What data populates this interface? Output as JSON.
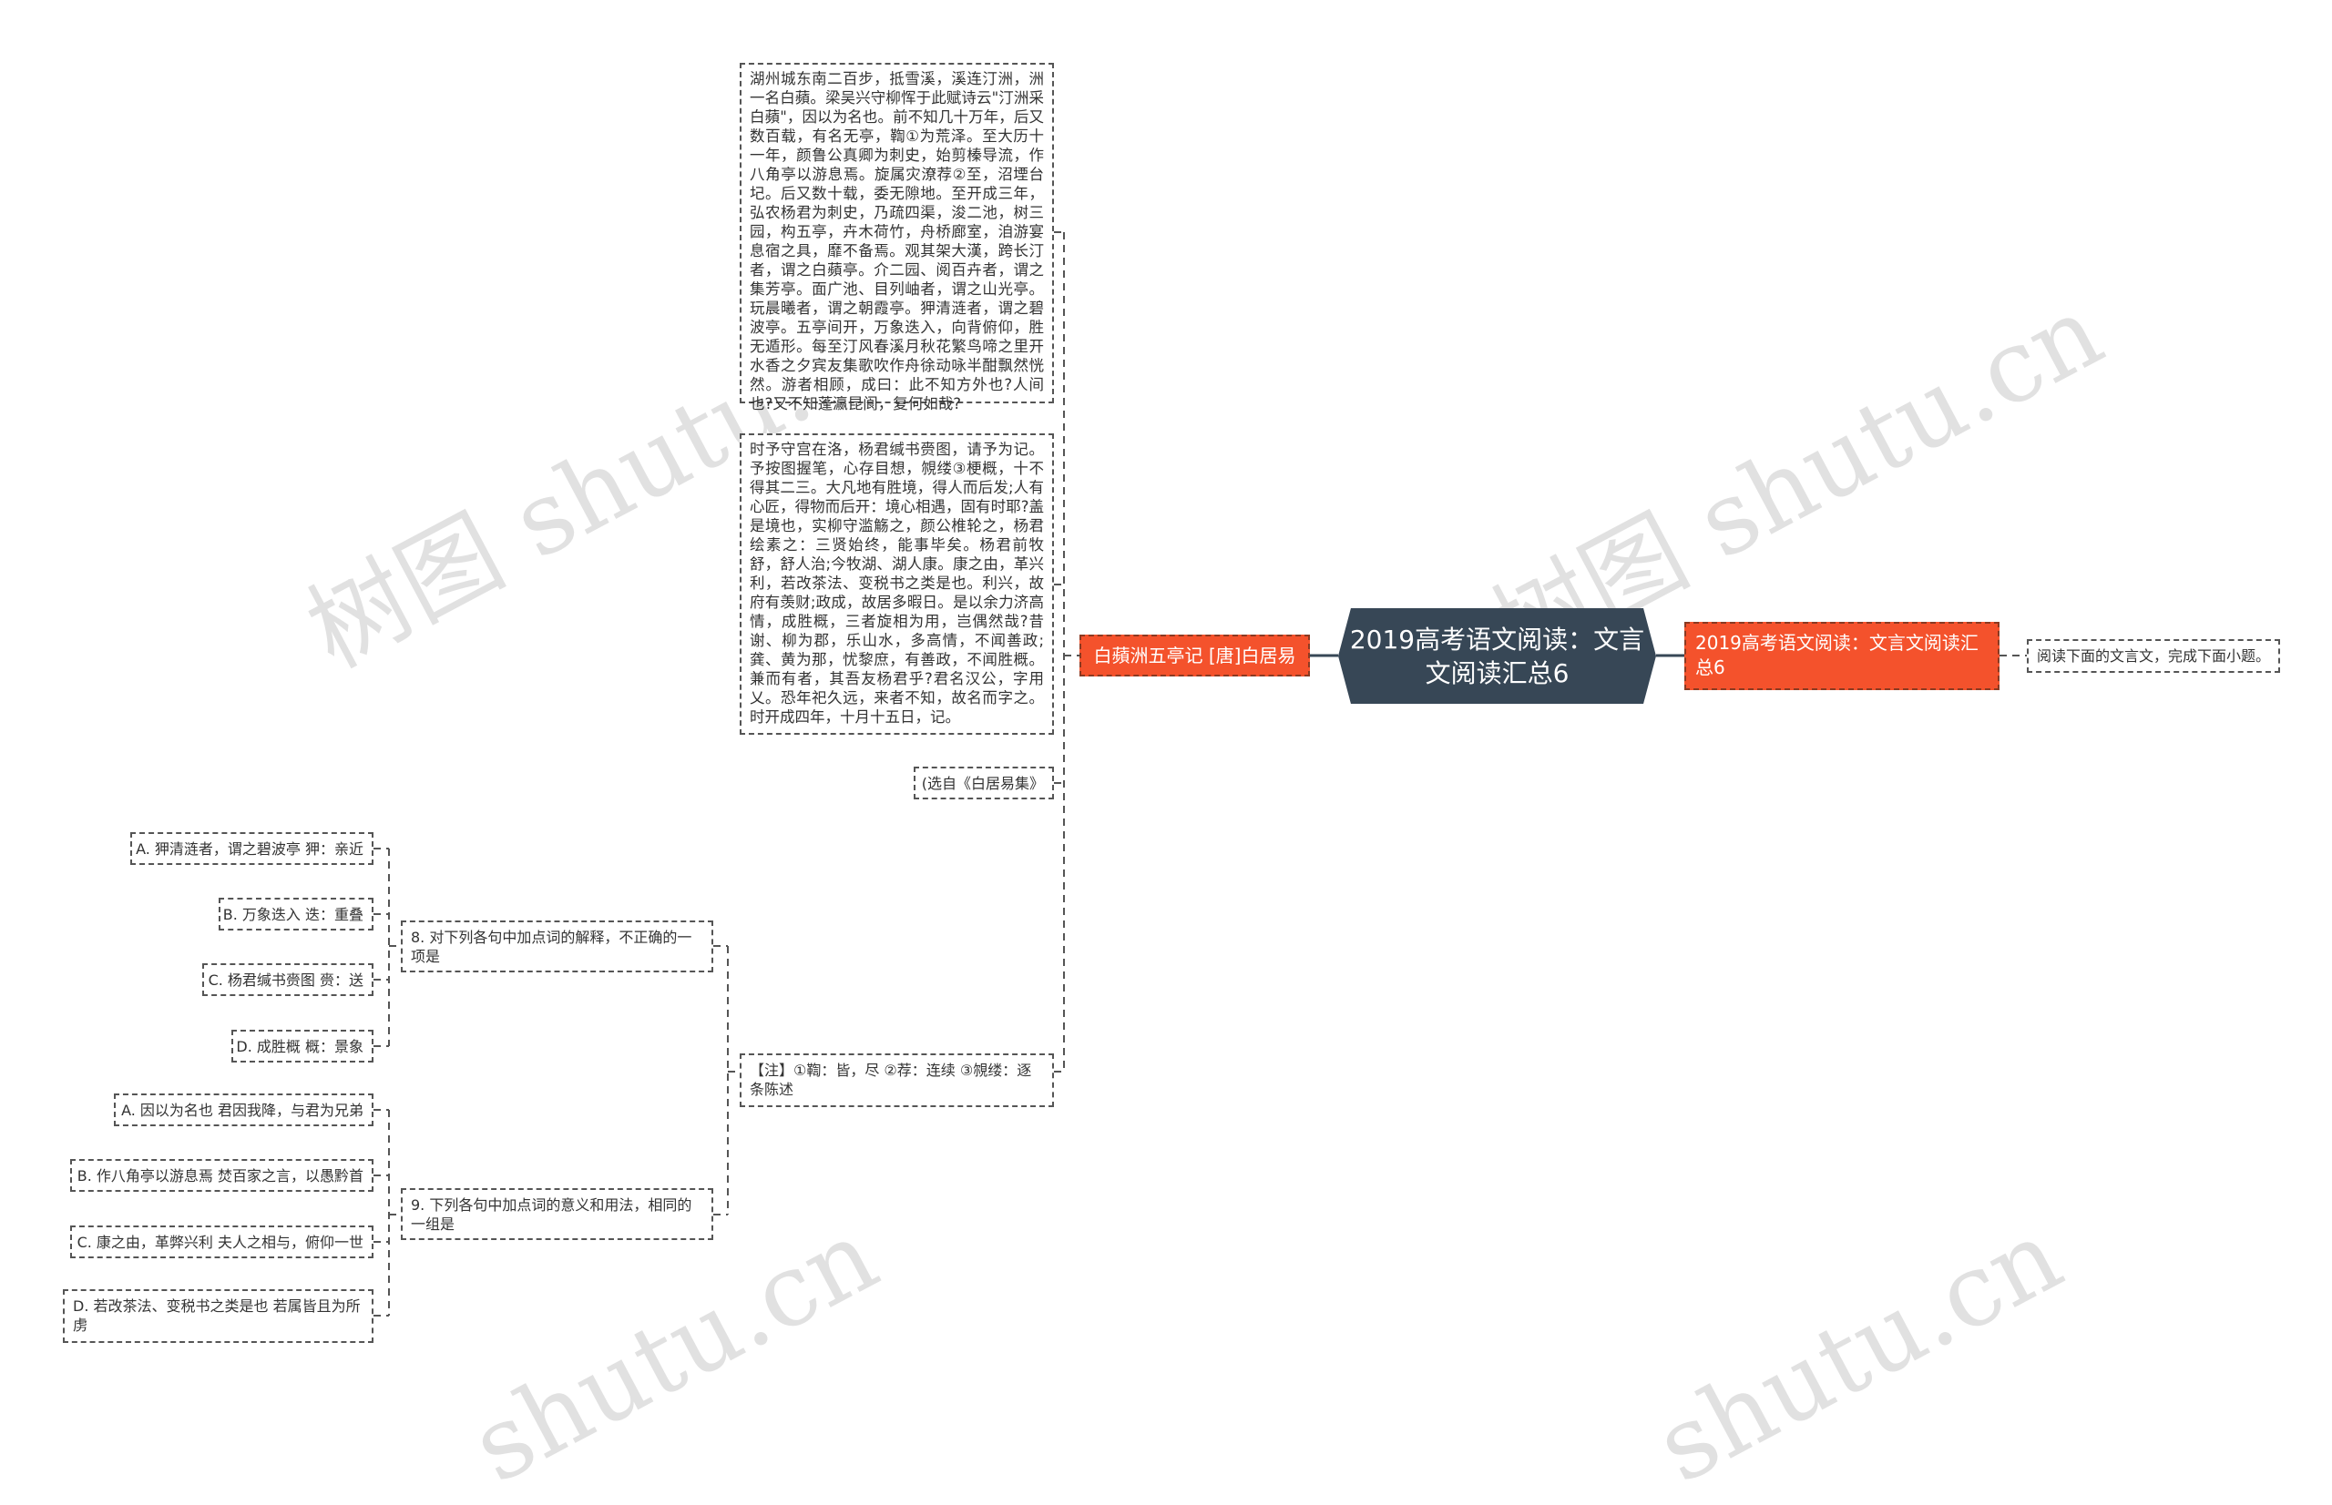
{
  "root": {
    "title": "2019高考语文阅读：文言文阅读汇总6"
  },
  "right_branch": {
    "label": "2019高考语文阅读：文言文阅读汇总6",
    "child": "阅读下面的文言文，完成下面小题。"
  },
  "left_branch": {
    "label": "白蘋洲五亭记 [唐]白居易",
    "passage_1": "湖州城东南二百步，抵雪溪，溪连汀洲，洲一名白蘋。梁吴兴守柳恽于此赋诗云\"汀洲采白蘋\"，因以为名也。前不知几十万年，后又数百载，有名无亭，鞫①为荒泽。至大历十一年，颜鲁公真卿为刺史，始剪榛导流，作八角亭以游息焉。旋属灾潦荐②至，沼堙台圮。后又数十载，委无隙地。至开成三年，弘农杨君为刺史，乃疏四渠，浚二池，树三园，构五亭，卉木荷竹，舟桥廊室，洎游宴息宿之具，靡不备焉。观其架大漢，跨长汀者，谓之白蘋亭。介二园、阅百卉者，谓之集芳亭。面广池、目列岫者，谓之山光亭。玩晨曦者，谓之朝霞亭。狎清涟者，谓之碧波亭。五亭间开，万象迭入，向背俯仰，胜无遁形。每至汀风春溪月秋花繁鸟啼之里开水香之夕宾友集歌吹作舟徐动咏半酣飘然恍然。游者相顾，成曰：此不知方外也?人间也?又不知蓬瀛昆阆，复何如哉?",
    "passage_2": "时予守宫在洛，杨君缄书赍图，请予为记。予按图握笔，心存目想，覙缕③梗概，十不得其二三。大凡地有胜境，得人而后发;人有心匠，得物而后开：境心相遇，固有时耶?盖是境也，实柳守滥觞之，颜公椎轮之，杨君绘素之：三贤始终，能事毕矣。杨君前牧舒，舒人治;今牧湖、湖人康。康之由，革兴利，若改茶法、变税书之类是也。利兴，故府有羡财;政成，故居多暇日。是以余力济高情，成胜概，三者旋相为用，岂偶然哉?昔谢、柳为郡，乐山水，多高情，不闻善政;龚、黄为那，忧黎庶，有善政，不闻胜概。兼而有者，其吾友杨君乎?君名汉公，字用乂。恐年祀久远，来者不知，故名而字之。时开成四年，十月十五日，记。",
    "source": "(选自《白居易集》",
    "note": "【注】①鞫：皆，尽 ②荐：连续 ③覙缕：逐条陈述",
    "questions": [
      {
        "label": "8. 对下列各句中加点词的解释，不正确的一项是",
        "options": [
          "A. 狎清涟者，谓之碧波亭 狎：亲近",
          "B. 万象迭入 迭：重叠",
          "C. 杨君缄书赍图 赍：送",
          "D. 成胜概 概：景象"
        ]
      },
      {
        "label": "9. 下列各句中加点词的意义和用法，相同的一组是",
        "options": [
          "A. 因以为名也 君因我降，与君为兄弟",
          "B. 作八角亭以游息焉 焚百家之言，以愚黔首",
          "C. 康之由，革弊兴利 夫人之相与，俯仰一世",
          "D. 若改茶法、变税书之类是也 若属皆且为所虏"
        ]
      }
    ]
  },
  "watermarks": [
    "树图 shutu.cn",
    "树图 shutu.cn",
    "shutu.cn",
    "shutu.cn"
  ],
  "colors": {
    "root": "#374756",
    "branch": "#f4522c",
    "line": "#555555"
  }
}
